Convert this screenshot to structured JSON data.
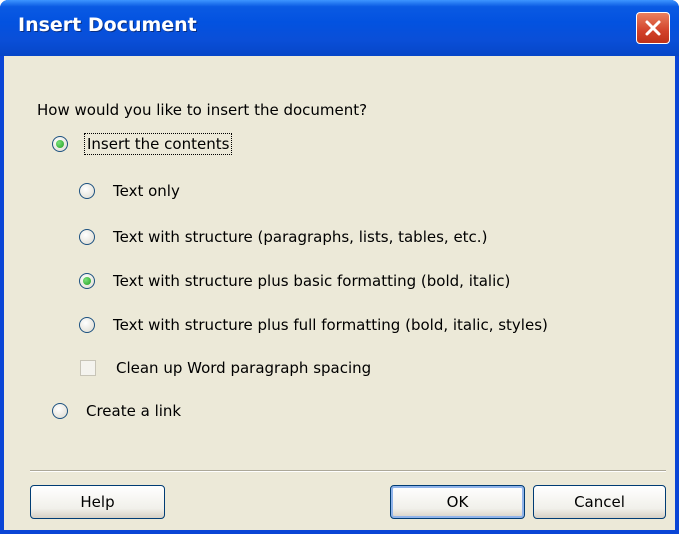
{
  "dialog": {
    "title": "Insert Document",
    "close_icon": "close-icon",
    "accent_color": "#0a45d6"
  },
  "prompt": "How would you like to insert the document?",
  "options": {
    "insert_contents": {
      "label": "Insert the contents",
      "selected": true
    },
    "text_only": {
      "label": "Text only",
      "selected": false
    },
    "text_with_structure": {
      "label": "Text with structure (paragraphs, lists, tables, etc.)",
      "selected": false
    },
    "structure_basic_formatting": {
      "label": "Text with structure plus basic formatting (bold, italic)",
      "selected": true
    },
    "structure_full_formatting": {
      "label": "Text with structure plus full formatting (bold, italic, styles)",
      "selected": false
    },
    "clean_up_spacing": {
      "label": "Clean up Word paragraph spacing",
      "checked": false
    },
    "create_link": {
      "label": "Create a link",
      "selected": false
    }
  },
  "buttons": {
    "help": "Help",
    "ok": "OK",
    "cancel": "Cancel"
  }
}
